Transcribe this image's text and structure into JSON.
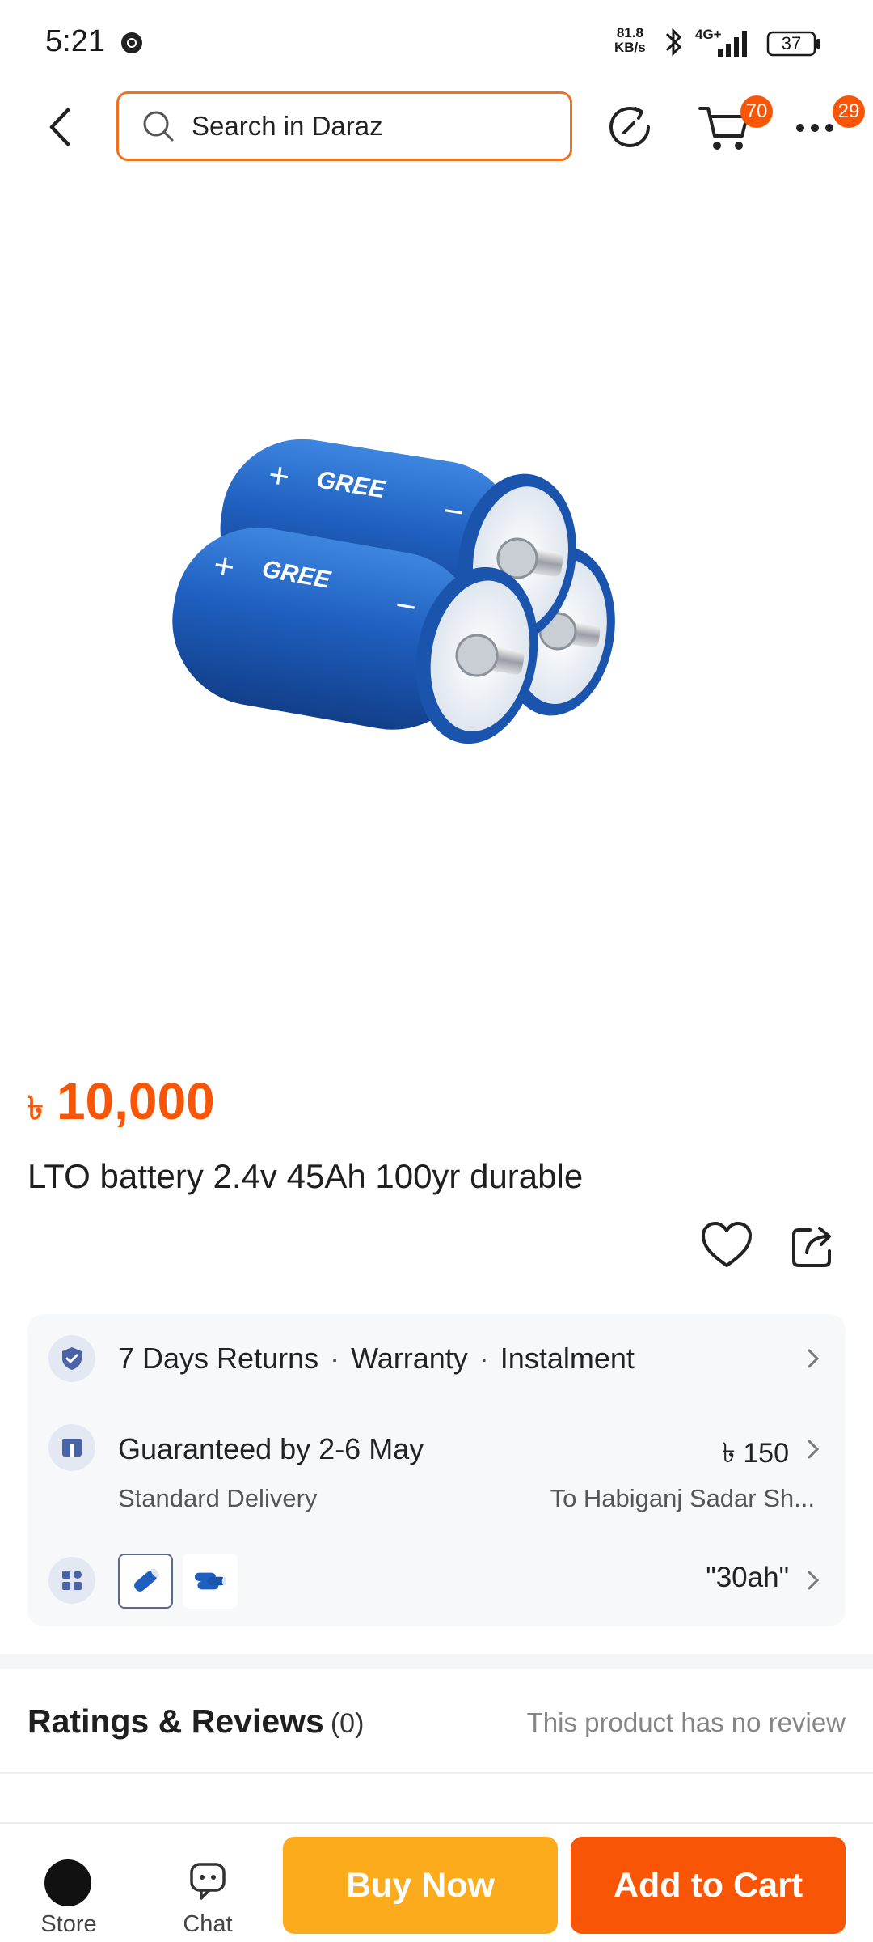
{
  "status_bar": {
    "time": "5:21",
    "net_speed_value": "81.8",
    "net_speed_unit": "KB/s",
    "network_type": "4G+",
    "battery": "37"
  },
  "nav": {
    "search_placeholder": "Search in Daraz",
    "cart_badge": "70",
    "more_badge": "29"
  },
  "product": {
    "currency": "৳",
    "price": "10,000",
    "title": "LTO battery 2.4v 45Ah 100yr durable",
    "image_brand_text": "GREE"
  },
  "info_card": {
    "services": [
      "7 Days Returns",
      "Warranty",
      "Instalment"
    ],
    "delivery_title": "Guaranteed by 2-6 May",
    "delivery_type": "Standard Delivery",
    "delivery_fee": "৳ 150",
    "delivery_location": "To Habiganj Sadar Sh...",
    "variant_selected": "\"30ah\""
  },
  "ratings": {
    "title": "Ratings & Reviews",
    "count": "(0)",
    "note": "This product has no review"
  },
  "bottom_bar": {
    "store_label": "Store",
    "chat_label": "Chat",
    "buy_now_label": "Buy Now",
    "add_to_cart_label": "Add to Cart"
  },
  "colors": {
    "accent": "#f85606",
    "buy_now": "#fbab1c",
    "battery_blue": "#1f5fbf"
  }
}
